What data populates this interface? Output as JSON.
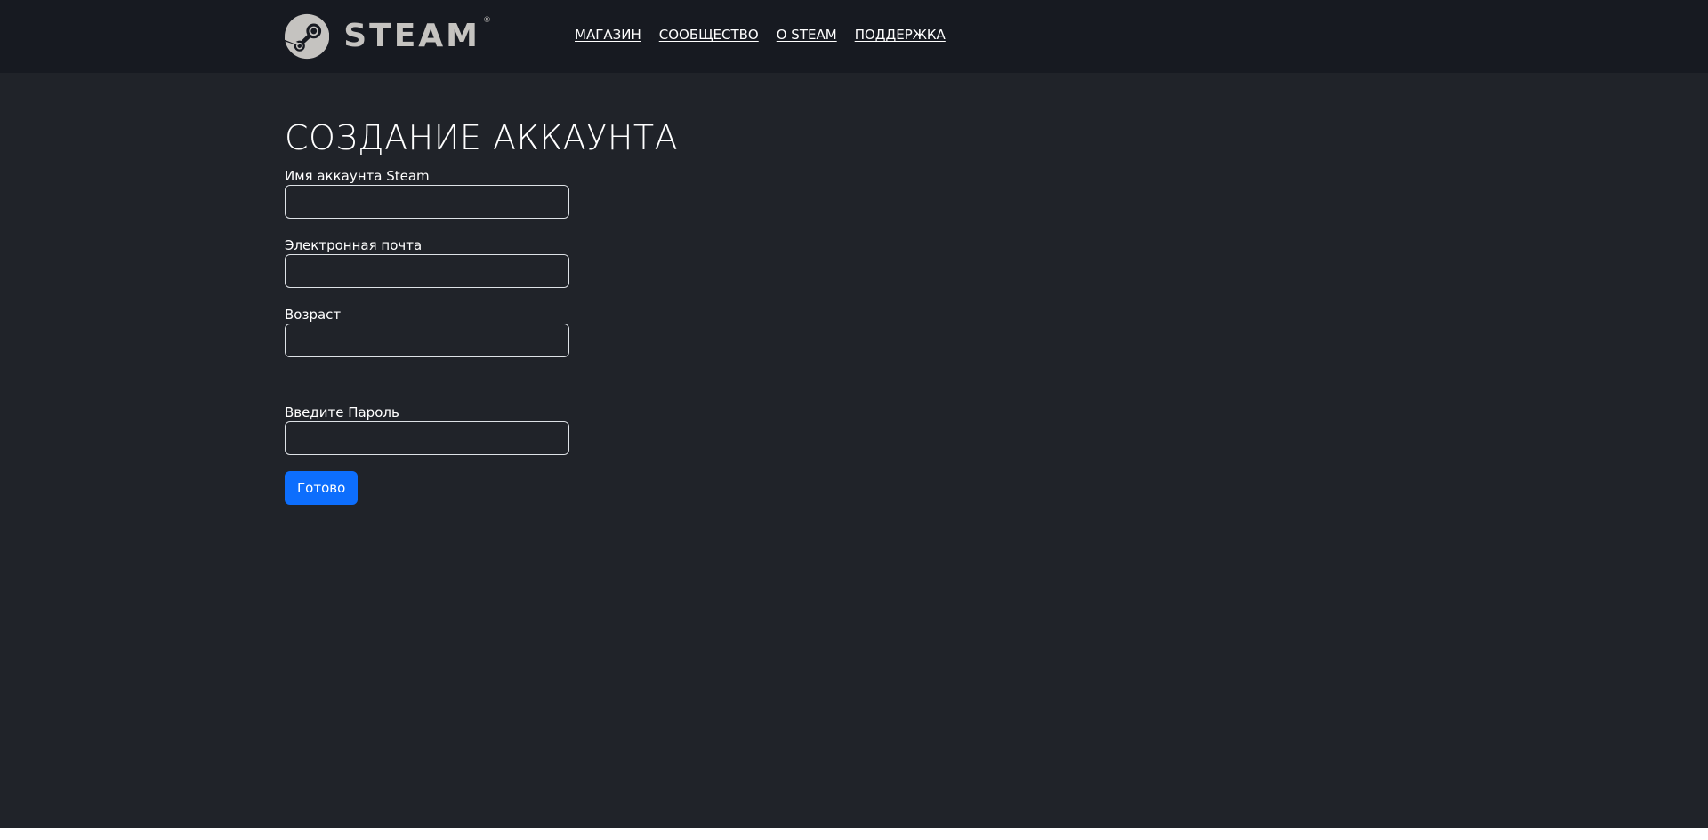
{
  "header": {
    "logo": {
      "icon": "steam-logo-icon",
      "wordmark": "STEAM",
      "registered_mark": "®",
      "mark_color": "#c5c3c0",
      "background": "#171a21"
    },
    "nav": [
      {
        "label": "МАГАЗИН"
      },
      {
        "label": "СООБЩЕСТВО"
      },
      {
        "label": "О STEAM"
      },
      {
        "label": "ПОДДЕРЖКА"
      }
    ]
  },
  "form": {
    "title": "СОЗДАНИЕ АККАУНТА",
    "fields": [
      {
        "label": "Имя аккаунта Steam",
        "value": ""
      },
      {
        "label": "Электронная почта",
        "value": ""
      },
      {
        "label": "Возраст",
        "value": ""
      },
      {
        "label": "Введите Пароль",
        "value": ""
      }
    ],
    "submit_label": "Готово",
    "submit_color": "#0d6efd"
  },
  "colors": {
    "page_background": "#202329",
    "header_background": "#171a21",
    "text": "#ffffff"
  }
}
